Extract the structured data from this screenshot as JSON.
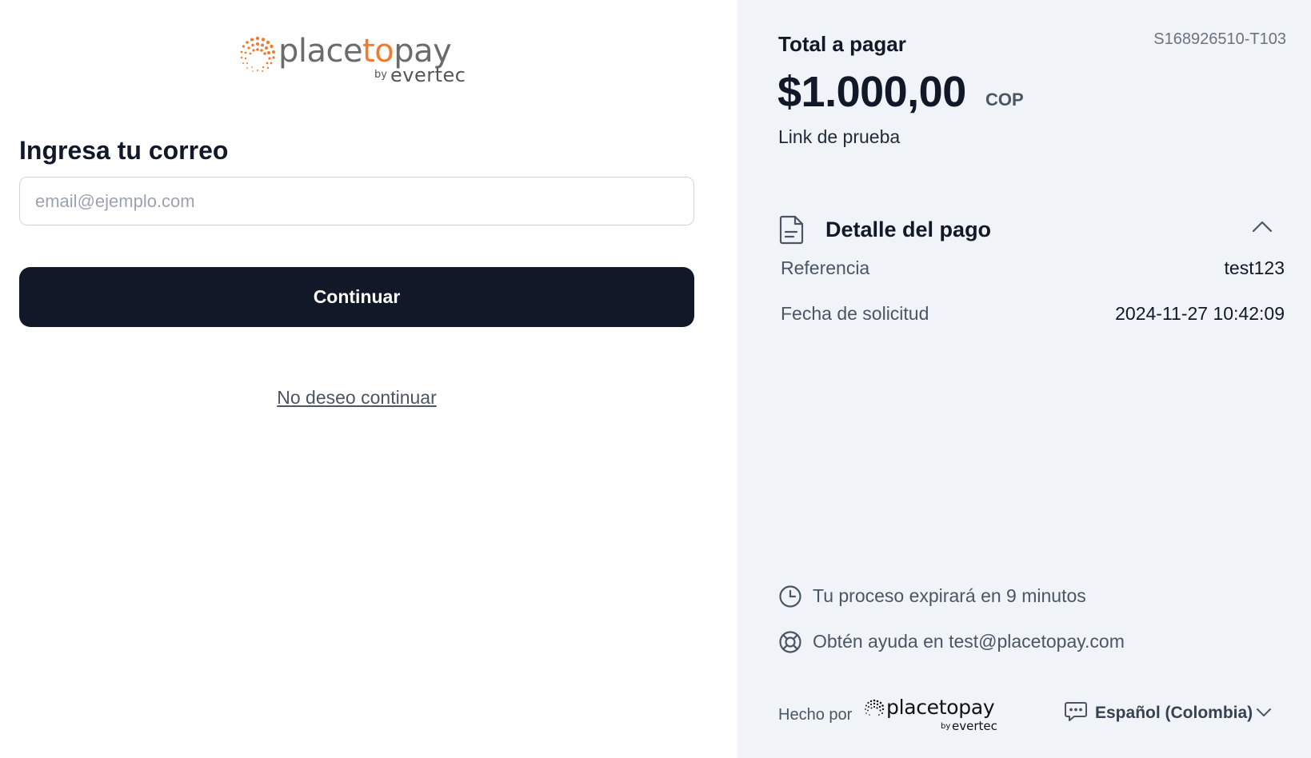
{
  "brand": {
    "logo_word_part1": "place",
    "logo_word_part2": "to",
    "logo_word_part3": "pay",
    "logo_by": "by",
    "logo_evertec": "evertec",
    "accent_color": "#ee7b2f"
  },
  "form": {
    "heading": "Ingresa tu correo",
    "email_placeholder": "email@ejemplo.com",
    "email_value": "",
    "continue_label": "Continuar",
    "cancel_link": "No deseo continuar"
  },
  "summary": {
    "total_label": "Total a pagar",
    "order_id": "S168926510-T103",
    "amount": "$1.000,00",
    "currency": "COP",
    "description": "Link de prueba"
  },
  "detail": {
    "title": "Detalle del pago",
    "rows": [
      {
        "label": "Referencia",
        "value": "test123"
      },
      {
        "label": "Fecha de solicitud",
        "value": "2024-11-27 10:42:09"
      }
    ]
  },
  "info": {
    "expire_text": "Tu proceso expirará en 9 minutos",
    "help_text": "Obtén ayuda en test@placetopay.com"
  },
  "footer": {
    "made_by": "Hecho por",
    "logo_word": "placetopay",
    "logo_by": "by",
    "logo_evertec": "evertec",
    "language": "Español (Colombia)"
  },
  "icons": {
    "document": "document-icon",
    "chevron_up": "chevron-up-icon",
    "clock": "clock-icon",
    "lifebuoy": "lifebuoy-icon",
    "chat": "chat-icon",
    "chevron_down": "chevron-down-icon"
  }
}
